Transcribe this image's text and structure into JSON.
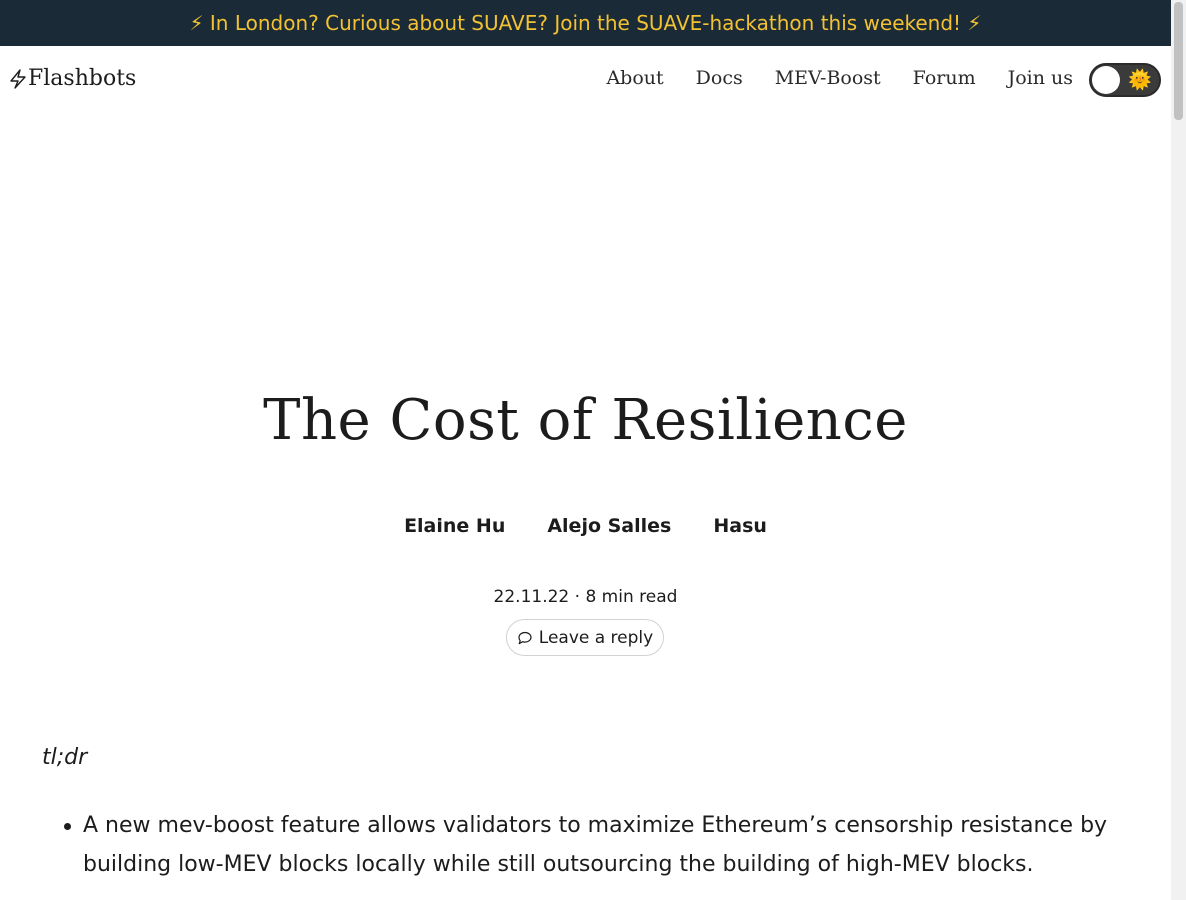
{
  "banner": {
    "text": "⚡ In London? Curious about SUAVE? Join the SUAVE-hackathon this weekend! ⚡"
  },
  "header": {
    "logo_text": "Flashbots",
    "nav": [
      "About",
      "Docs",
      "MEV-Boost",
      "Forum",
      "Join us"
    ],
    "theme_toggle": {
      "state": "light",
      "icon": "sun-icon",
      "glyph": "🌞"
    }
  },
  "article": {
    "title": "The Cost of Resilience",
    "authors": [
      "Elaine Hu",
      "Alejo Salles",
      "Hasu"
    ],
    "meta": "22.11.22 · 8 min read",
    "reply_label": "Leave a reply",
    "tldr": "tl;dr",
    "bullets": [
      "A new mev-boost feature allows validators to maximize Ethereum’s censorship resistance by building low-MEV blocks locally while still outsourcing the building of high-MEV blocks."
    ]
  }
}
